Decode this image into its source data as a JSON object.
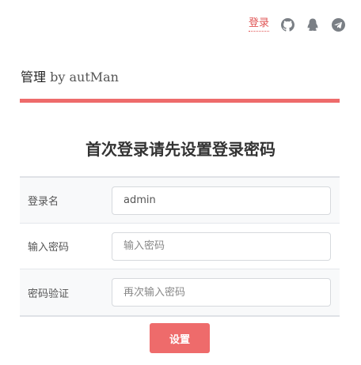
{
  "top_nav": {
    "login_label": "登录",
    "icons": [
      "github-icon",
      "qq-penguin-icon",
      "telegram-icon"
    ]
  },
  "header": {
    "title_main": "管理",
    "title_sub": "by autMan"
  },
  "form": {
    "heading": "首次登录请先设置登录密码",
    "fields": [
      {
        "label": "登录名",
        "value": "admin",
        "placeholder": ""
      },
      {
        "label": "输入密码",
        "value": "",
        "placeholder": "输入密码"
      },
      {
        "label": "密码验证",
        "value": "",
        "placeholder": "再次输入密码"
      }
    ],
    "submit_label": "设置"
  },
  "colors": {
    "accent": "#ee6b6b",
    "login_link": "#e05555",
    "icon_gray": "#7a7f85"
  }
}
